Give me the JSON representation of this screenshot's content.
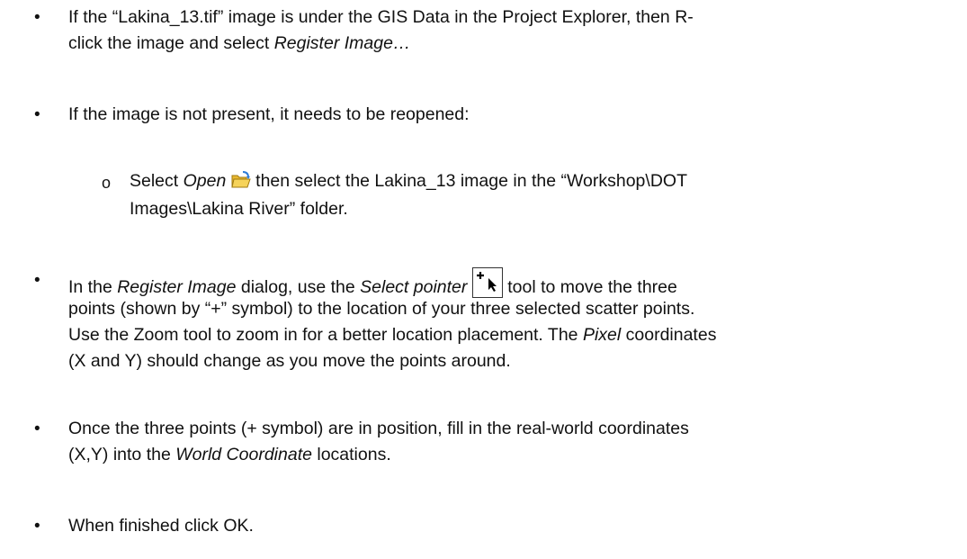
{
  "bullet_char": "•",
  "sub_bullet_char": "o",
  "items": [
    {
      "p1": "If the “Lakina_13.tif” image is under the GIS Data in the Project Explorer, then R-",
      "p2": "click the image and select ",
      "p3": "Register Image…"
    },
    {
      "p1": "If the image is not present, it needs to be reopened:"
    },
    {
      "sub": {
        "p1": "Select ",
        "p2": "Open",
        "p3": " then select the Lakina_13 image in the “Workshop\\DOT",
        "p4": "Images\\Lakina River” folder."
      }
    },
    {
      "p1": "In the ",
      "p2": "Register Image",
      "p3": " dialog, use the ",
      "p4": "Select pointer",
      "p5": " tool to move the three",
      "p6": "points (shown by “+” symbol) to the location of your three selected scatter points.",
      "p7": "Use the Zoom tool to zoom in for a better location placement. The ",
      "p8": "Pixel",
      "p9": " coordinates",
      "p10": "(X and Y) should change as you move the points around."
    },
    {
      "p1": "Once the three points (+ symbol) are in position, fill in the real-world coordinates",
      "p2": "(X,Y) into the ",
      "p3": "World Coordinate",
      "p4": " locations."
    },
    {
      "p1": "When finished click OK."
    }
  ],
  "icons": {
    "open": "open-folder-icon",
    "pointer": "select-pointer-icon"
  }
}
